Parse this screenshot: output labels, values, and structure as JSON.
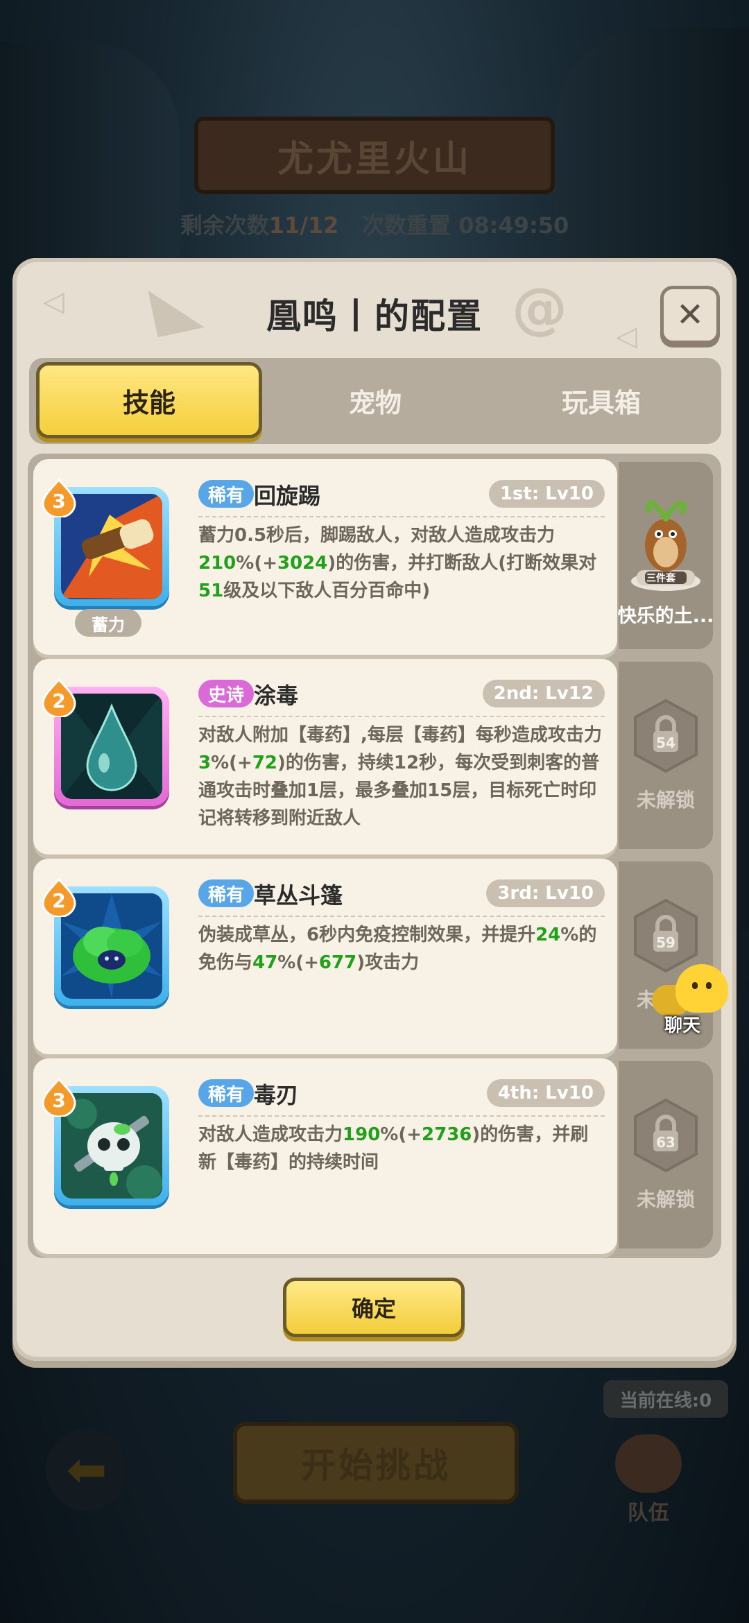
{
  "background": {
    "stage_title": "尤尤里火山",
    "attempts_label": "剩余次数",
    "attempts_value": "11/12",
    "reset_label": "次数重置",
    "reset_time": "08:49:50",
    "start_button": "开始挑战",
    "online_text": "当前在线:0",
    "team_label": "队伍"
  },
  "modal": {
    "title": "凰鸣丨的配置",
    "close_icon": "close-x-icon",
    "tabs": [
      {
        "label": "技能",
        "active": true
      },
      {
        "label": "宠物",
        "active": false
      },
      {
        "label": "玩具箱",
        "active": false
      }
    ],
    "confirm_label": "确定"
  },
  "skills": [
    {
      "rarity": "稀有",
      "rarity_color": "#58a6e8",
      "name": "回旋踢",
      "slot": "1st: Lv10",
      "level": "3",
      "tag": "蓄力",
      "icon": "kick-icon",
      "desc": [
        {
          "t": "蓄力0.5秒后，脚踢敌人，对敌人造成攻击力"
        },
        {
          "t": "210",
          "g": true
        },
        {
          "t": "%(+"
        },
        {
          "t": "3024",
          "g": true
        },
        {
          "t": ")的伤害，并打断敌人(打断效果对"
        },
        {
          "t": "51",
          "g": true
        },
        {
          "t": "级及以下敌人百分百命中)"
        }
      ]
    },
    {
      "rarity": "史诗",
      "rarity_color": "#d96ad6",
      "name": "涂毒",
      "slot": "2nd: Lv12",
      "level": "2",
      "tag": "",
      "icon": "poison-drop-icon",
      "desc": [
        {
          "t": "对敌人附加【毒药】,每层【毒药】每秒造成攻击力"
        },
        {
          "t": "3",
          "g": true
        },
        {
          "t": "%(+"
        },
        {
          "t": "72",
          "g": true
        },
        {
          "t": ")的伤害，持续12秒，每次受到刺客的普通攻击时叠加1层，最多叠加15层，目标死亡时印记将转移到附近敌人"
        }
      ]
    },
    {
      "rarity": "稀有",
      "rarity_color": "#58a6e8",
      "name": "草丛斗篷",
      "slot": "3rd: Lv10",
      "level": "2",
      "tag": "",
      "icon": "bush-cloak-icon",
      "desc": [
        {
          "t": "伪装成草丛，6秒内免疫控制效果，并提升"
        },
        {
          "t": "24",
          "g": true
        },
        {
          "t": "%的免伤与"
        },
        {
          "t": "47",
          "g": true
        },
        {
          "t": "%(+"
        },
        {
          "t": "677",
          "g": true
        },
        {
          "t": ")攻击力"
        }
      ]
    },
    {
      "rarity": "稀有",
      "rarity_color": "#58a6e8",
      "name": "毒刃",
      "slot": "4th: Lv10",
      "level": "3",
      "tag": "",
      "icon": "poison-skull-blade-icon",
      "desc": [
        {
          "t": "对敌人造成攻击力"
        },
        {
          "t": "190",
          "g": true
        },
        {
          "t": "%(+"
        },
        {
          "t": "2736",
          "g": true
        },
        {
          "t": ")的伤害，并刷新【毒药】的持续时间"
        }
      ]
    }
  ],
  "side_slots": [
    {
      "type": "pet",
      "badge": "三件套",
      "label": "快乐的土...",
      "icon": "mole-pet-icon"
    },
    {
      "type": "locked",
      "level": "54",
      "label": "未解锁"
    },
    {
      "type": "locked",
      "level": "59",
      "label": "未解锁"
    },
    {
      "type": "locked",
      "level": "63",
      "label": "未解锁"
    }
  ],
  "chat": {
    "label": "聊天",
    "icon": "chat-face-icon"
  }
}
